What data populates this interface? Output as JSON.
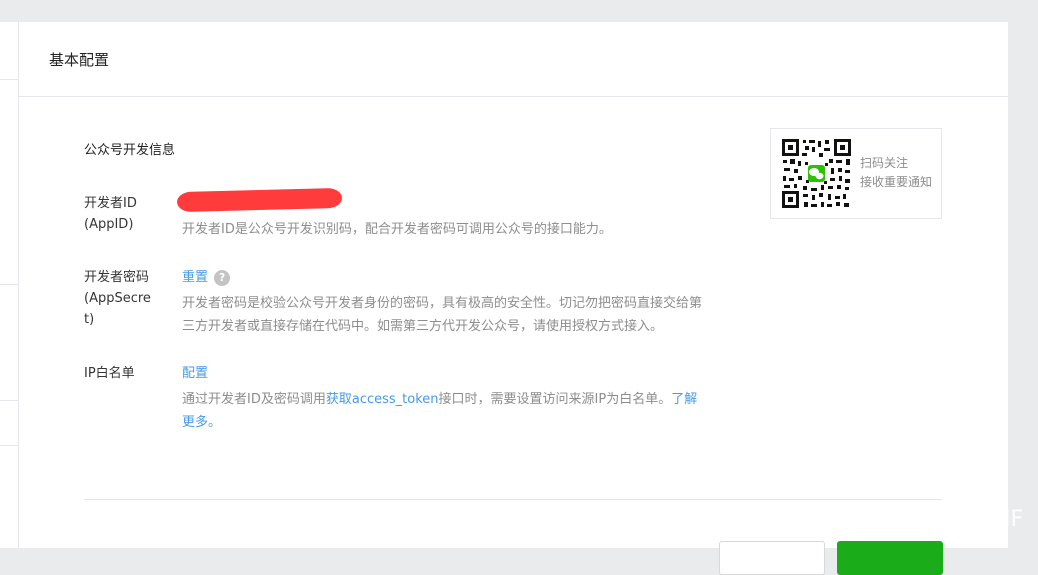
{
  "header": {
    "title": "基本配置"
  },
  "section": {
    "title": "公众号开发信息"
  },
  "appid": {
    "label_line1": "开发者ID",
    "label_line2": "(AppID)",
    "description": "开发者ID是公众号开发识别码，配合开发者密码可调用公众号的接口能力。"
  },
  "appsecret": {
    "label_line1": "开发者密码",
    "label_line2": "(AppSecre",
    "label_line3": "t)",
    "action": "重置",
    "help": "?",
    "description_line1": "开发者密码是校验公众号开发者身份的密码，具有极高的安全性。切记勿把密码直接交给第",
    "description_line2": "三方开发者或直接存储在代码中。如需第三方代开发公众号，请使用授权方式接入。"
  },
  "ip_whitelist": {
    "label": "IP白名单",
    "action": "配置",
    "desc_part1": "通过开发者ID及密码调用",
    "desc_link": "获取access_token",
    "desc_part2": "接口时，需要设置访问来源IP为白名单。",
    "more_link_part1": "了解",
    "more_link_part2": "更多。"
  },
  "qr": {
    "line1": "扫码关注",
    "line2": "接收重要通知"
  },
  "watermark": "IF",
  "colors": {
    "link": "#459ae9",
    "primary": "#1aad19",
    "redaction": "#ff3b3b"
  }
}
